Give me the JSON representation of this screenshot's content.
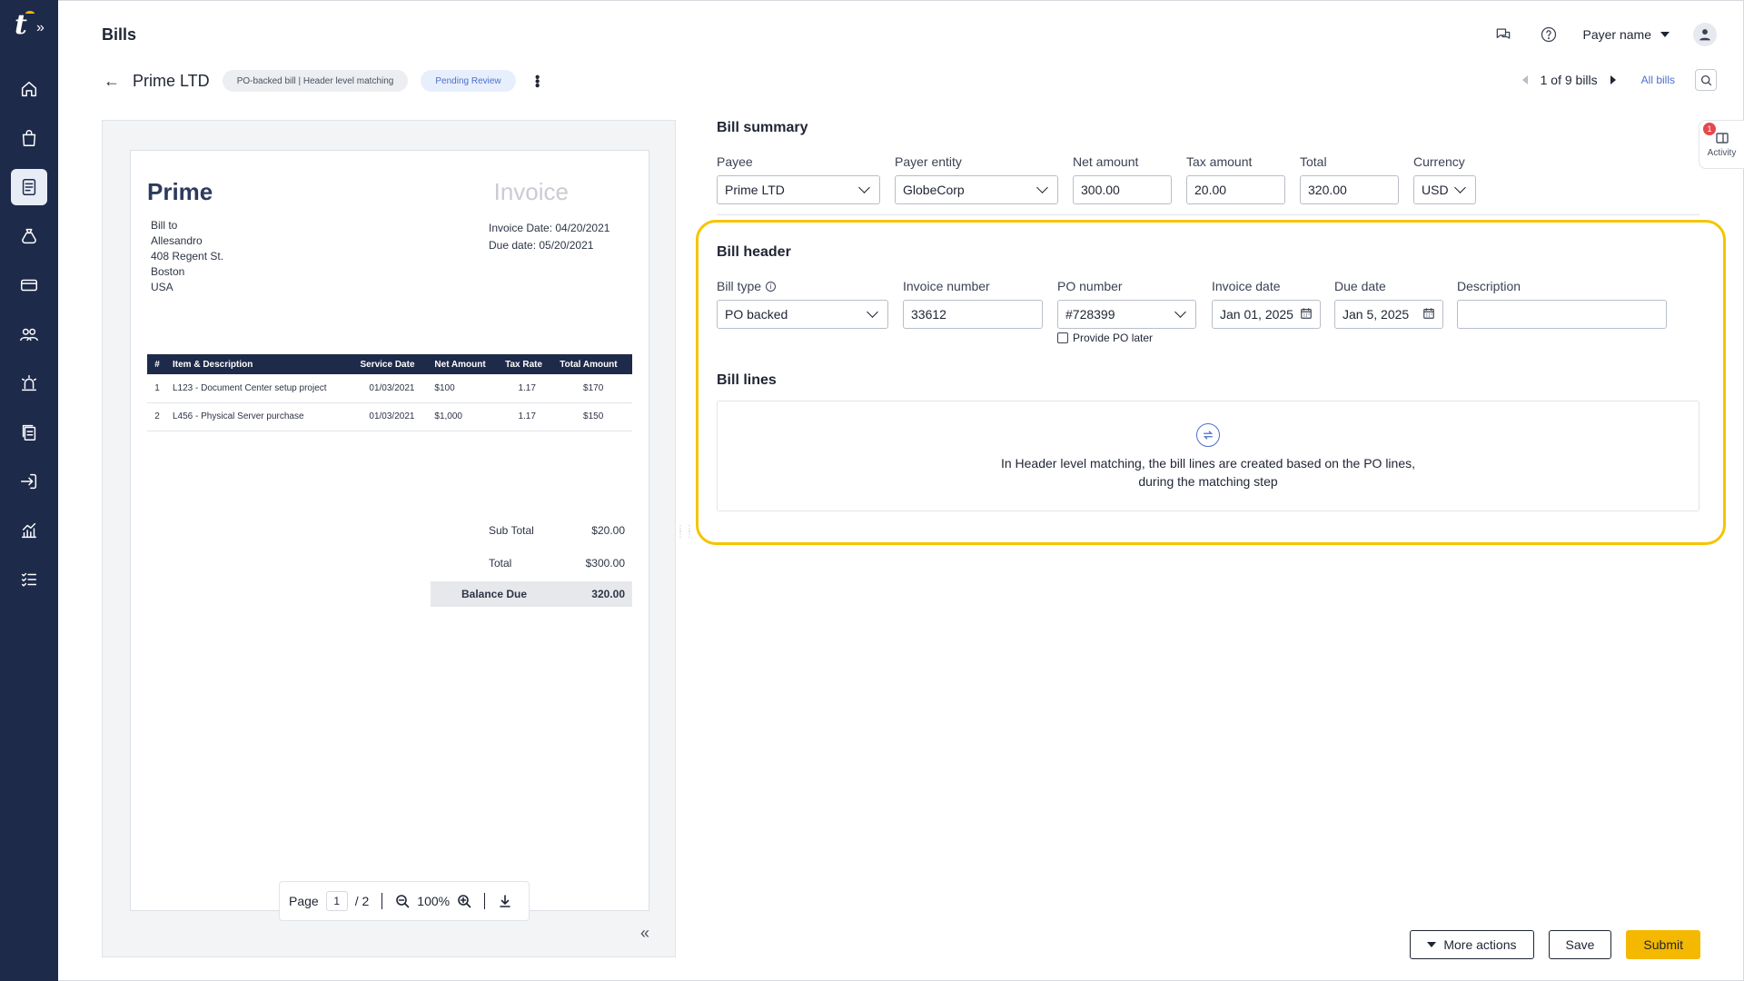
{
  "app": {
    "page_title": "Bills"
  },
  "topbar": {
    "payer_name": "Payer name",
    "icons": [
      "chat-icon",
      "help-icon",
      "user-icon"
    ]
  },
  "bill": {
    "vendor": "Prime LTD",
    "type_chip": "PO-backed bill | Header level matching",
    "status_chip": "Pending Review"
  },
  "pager": {
    "position": "1 of 9 bills",
    "all_bills": "All bills"
  },
  "activity": {
    "label": "Activity",
    "count": "1"
  },
  "invoice": {
    "brand": "Prime",
    "title": "Invoice",
    "bill_to": [
      "Bill to",
      "Allesandro",
      "408 Regent St.",
      "Boston",
      "USA"
    ],
    "invoice_date": "Invoice Date: 04/20/2021",
    "due_date": "Due date: 05/20/2021",
    "columns": [
      "#",
      "Item & Description",
      "Service Date",
      "Net Amount",
      "Tax Rate",
      "Total Amount"
    ],
    "rows": [
      [
        "1",
        "L123 - Document Center setup project",
        "01/03/2021",
        "$100",
        "1.17",
        "$170"
      ],
      [
        "2",
        "L456 - Physical Server purchase",
        "01/03/2021",
        "$1,000",
        "1.17",
        "$150"
      ]
    ],
    "sub_total_label": "Sub Total",
    "sub_total": "$20.00",
    "total_label": "Total",
    "total": "$300.00",
    "balance_label": "Balance Due",
    "balance": "320.00"
  },
  "viewer": {
    "page_label": "Page",
    "page": "1",
    "of": "/ 2",
    "zoom": "100%"
  },
  "summary": {
    "title": "Bill summary",
    "payee_label": "Payee",
    "payee": "Prime LTD",
    "entity_label": "Payer entity",
    "entity": "GlobeCorp",
    "net_label": "Net amount",
    "net": "300.00",
    "tax_label": "Tax amount",
    "tax": "20.00",
    "total_label": "Total",
    "total": "320.00",
    "currency_label": "Currency",
    "currency": "USD"
  },
  "header": {
    "title": "Bill header",
    "type_label": "Bill type",
    "type": "PO backed",
    "invoice_no_label": "Invoice number",
    "invoice_no": "33612",
    "po_label": "PO number",
    "po": "#728399",
    "po_later": "Provide PO later",
    "inv_date_label": "Invoice date",
    "inv_date": "Jan 01, 2025",
    "due_label": "Due date",
    "due": "Jan 5, 2025",
    "desc_label": "Description",
    "desc": ""
  },
  "lines": {
    "title": "Bill lines",
    "message_1": "In Header level matching, the bill lines are created based on the PO lines,",
    "message_2": "during the matching step"
  },
  "actions": {
    "more": "More actions",
    "save": "Save",
    "submit": "Submit"
  },
  "colors": {
    "sidebar": "#1e2a4a",
    "accent": "#f5b800",
    "link": "#4b6fd1",
    "highlight": "#f5c400"
  }
}
